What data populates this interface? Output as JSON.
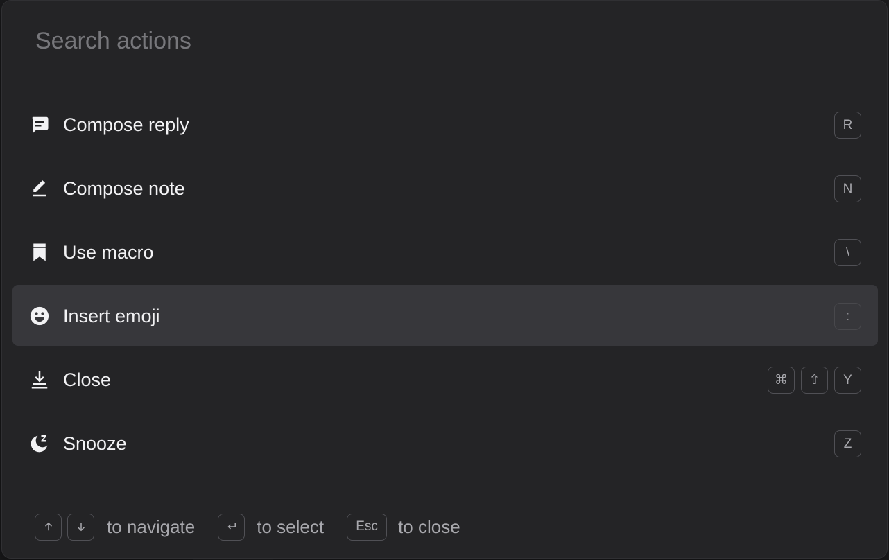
{
  "search": {
    "placeholder": "Search actions",
    "value": ""
  },
  "actions": [
    {
      "label": "Compose reply",
      "icon": "chat-bubble-icon",
      "keys": [
        "R"
      ]
    },
    {
      "label": "Compose note",
      "icon": "pen-icon",
      "keys": [
        "N"
      ]
    },
    {
      "label": "Use macro",
      "icon": "bookmark-icon",
      "keys": [
        "\\"
      ]
    },
    {
      "label": "Insert emoji",
      "icon": "smiley-icon",
      "keys": [
        ":"
      ],
      "active": true
    },
    {
      "label": "Close",
      "icon": "download-tray-icon",
      "keys": [
        "⌘",
        "⇧",
        "Y"
      ]
    },
    {
      "label": "Snooze",
      "icon": "moon-z-icon",
      "keys": [
        "Z"
      ]
    }
  ],
  "footer": {
    "navigate_text": "to navigate",
    "select_text": "to select",
    "esc_key": "Esc",
    "close_text": "to close"
  },
  "colors": {
    "panel_bg": "#242426",
    "active_row_bg": "#37373b",
    "text_primary": "#f2f2f4",
    "text_muted": "#a8a8ad"
  }
}
